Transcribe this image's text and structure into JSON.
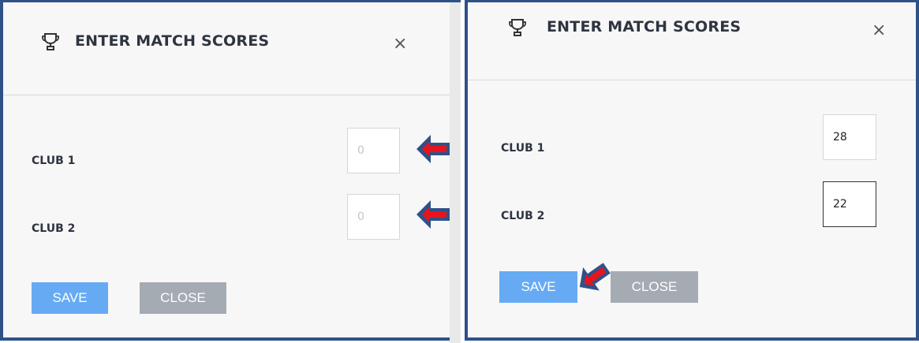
{
  "colors": {
    "frame_border": "#2f5189",
    "save_button": "#66aaf3",
    "close_button": "#a5abb3",
    "arrow_fill": "#e8141b",
    "arrow_outline": "#2f5189"
  },
  "left_dialog": {
    "title": "ENTER MATCH SCORES",
    "title_icon": "trophy-icon",
    "close_glyph": "×",
    "club1_label": "CLUB 1",
    "club1_placeholder": "0",
    "club1_value": "",
    "club2_label": "CLUB 2",
    "club2_placeholder": "0",
    "club2_value": "",
    "save_label": "SAVE",
    "close_label": "CLOSE"
  },
  "right_dialog": {
    "title": "ENTER MATCH SCORES",
    "title_icon": "trophy-icon",
    "close_glyph": "×",
    "club1_label": "CLUB 1",
    "club1_value": "28",
    "club2_label": "CLUB 2",
    "club2_value": "22",
    "save_label": "SAVE",
    "close_label": "CLOSE"
  },
  "annotations": {
    "arrow_icon": "red-arrow-icon"
  }
}
